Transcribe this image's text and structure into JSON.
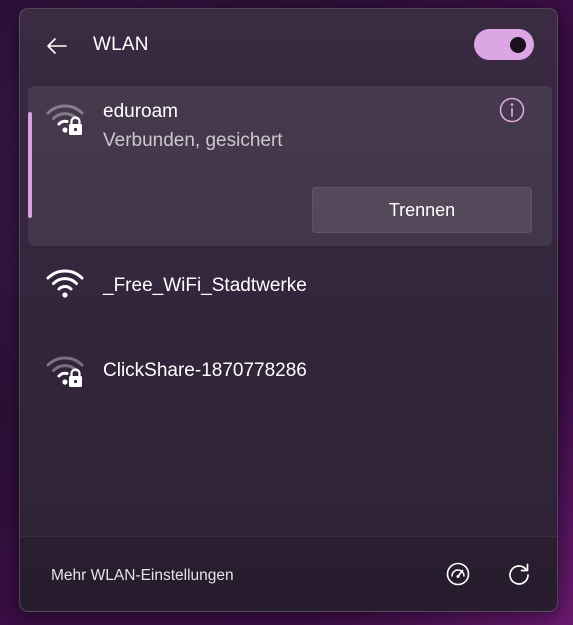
{
  "header": {
    "title": "WLAN",
    "back_icon": "back-arrow-icon",
    "toggle_state": "on",
    "accent_color": "#dba6e3"
  },
  "connected_network": {
    "name": "eduroam",
    "status": "Verbunden, gesichert",
    "secured": true,
    "disconnect_label": "Trennen",
    "info_icon": "info-icon"
  },
  "networks": [
    {
      "name": "_Free_WiFi_Stadtwerke",
      "secured": false
    },
    {
      "name": "ClickShare-1870778286",
      "secured": true
    }
  ],
  "footer": {
    "settings_link": "Mehr WLAN-Einstellungen",
    "icons": [
      "speedometer-icon",
      "refresh-icon"
    ]
  }
}
